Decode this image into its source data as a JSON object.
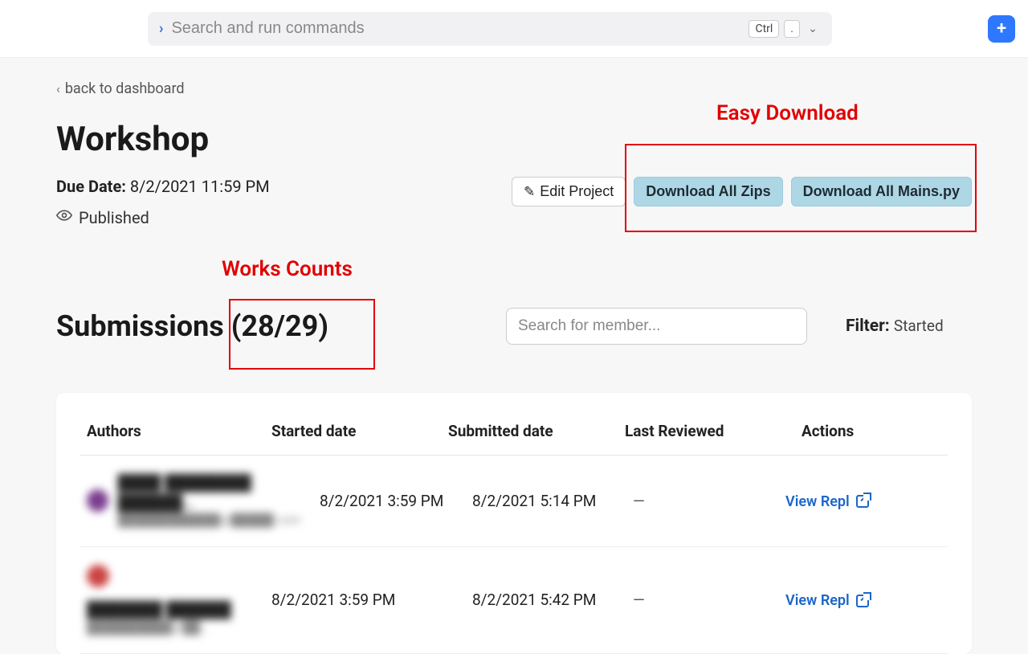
{
  "topbar": {
    "search_placeholder": "Search and run commands",
    "shortcut_1": "Ctrl",
    "shortcut_2": "."
  },
  "nav": {
    "back_label": "back to dashboard"
  },
  "project": {
    "title": "Workshop",
    "due_label": "Due Date:",
    "due_value": "8/2/2021 11:59 PM",
    "published_label": "Published",
    "edit_button": "Edit Project",
    "download_zips": "Download All Zips",
    "download_mains": "Download All Mains.py"
  },
  "annotations": {
    "easy_download": "Easy Download",
    "works_counts": "Works Counts"
  },
  "submissions": {
    "title_prefix": "Submissions",
    "count": "(28/29)",
    "member_search_placeholder": "Search for member...",
    "filter_label": "Filter:",
    "filter_value": "Started"
  },
  "table": {
    "cols": {
      "authors": "Authors",
      "started": "Started date",
      "submitted": "Submitted date",
      "reviewed": "Last Reviewed",
      "actions": "Actions"
    },
    "action_link": "View Repl",
    "dash": "—",
    "rows": [
      {
        "started": "8/2/2021 3:59 PM",
        "submitted": "8/2/2021 5:14 PM"
      },
      {
        "started": "8/2/2021 3:59 PM",
        "submitted": "8/2/2021 5:42 PM"
      }
    ]
  }
}
